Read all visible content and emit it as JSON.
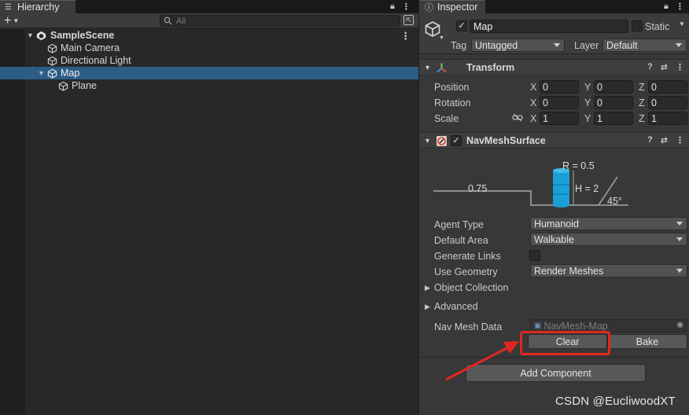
{
  "hierarchy": {
    "tab_title": "Hierarchy",
    "search_placeholder": "All",
    "scene": "SampleScene",
    "items": [
      {
        "label": "Main Camera"
      },
      {
        "label": "Directional Light"
      },
      {
        "label": "Map",
        "selected": true
      },
      {
        "label": "Plane"
      }
    ]
  },
  "inspector": {
    "tab_title": "Inspector",
    "object_name": "Map",
    "static_label": "Static",
    "tag_label": "Tag",
    "tag_value": "Untagged",
    "layer_label": "Layer",
    "layer_value": "Default",
    "transform": {
      "title": "Transform",
      "rows": [
        {
          "label": "Position",
          "x": "0",
          "y": "0",
          "z": "0"
        },
        {
          "label": "Rotation",
          "x": "0",
          "y": "0",
          "z": "0"
        },
        {
          "label": "Scale",
          "x": "1",
          "y": "1",
          "z": "1"
        }
      ],
      "axis_x": "X",
      "axis_y": "Y",
      "axis_z": "Z"
    },
    "navmesh": {
      "title": "NavMeshSurface",
      "diagram": {
        "radius": "R = 0.5",
        "height": "H = 2",
        "step": "0.75",
        "slope": "45°"
      },
      "agent_type_label": "Agent Type",
      "agent_type_value": "Humanoid",
      "default_area_label": "Default Area",
      "default_area_value": "Walkable",
      "generate_links_label": "Generate Links",
      "use_geometry_label": "Use Geometry",
      "use_geometry_value": "Render Meshes",
      "object_collection_label": "Object Collection",
      "advanced_label": "Advanced",
      "nav_mesh_data_label": "Nav Mesh Data",
      "nav_mesh_data_value": "NavMesh-Map",
      "clear_label": "Clear",
      "bake_label": "Bake"
    },
    "add_component_label": "Add Component"
  },
  "annotation": {
    "color": "#e0271f"
  },
  "watermark": "CSDN @EucliwoodXT",
  "colors": {
    "selection": "#2c5d87",
    "cylinder": "#1aa0d6"
  }
}
